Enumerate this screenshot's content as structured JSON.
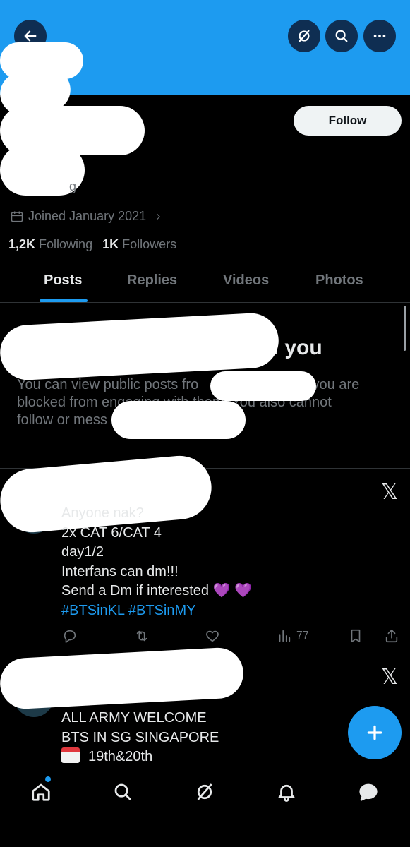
{
  "header": {
    "back_icon": "arrow-left-icon",
    "grok_icon": "grok-icon",
    "search_icon": "search-icon",
    "more_icon": "more-dots-icon",
    "banner_color": "#1d9bf0"
  },
  "profile": {
    "follow_label": "Follow",
    "handle_fragment": "g",
    "joined": "Joined January 2021",
    "following_count": "1,2K",
    "following_label": "Following",
    "followers_count": "1K",
    "followers_label": "Followers"
  },
  "tabs": [
    {
      "label": "Posts",
      "active": true
    },
    {
      "label": "Replies",
      "active": false
    },
    {
      "label": "Videos",
      "active": false
    },
    {
      "label": "Photos",
      "active": false
    }
  ],
  "blocked_notice": {
    "title_fragment": "ed you",
    "line1_a": "You can view public posts fro",
    "line1_b": "out you are",
    "line2": "blocked from engaging with them. You also cannot",
    "line3": "follow or mess"
  },
  "posts": [
    {
      "lines": [
        "Anyone nak?",
        "2x CAT 6/CAT 4",
        "day1/2",
        "Interfans can dm!!!",
        "Send a Dm if interested 💜 💜"
      ],
      "hashtags": "#BTSinKL #BTSinMY",
      "views": "77"
    },
    {
      "lines": [
        "ALL ARMY WELCOME",
        "BTS IN SG SINGAPORE",
        "19th&20th"
      ]
    }
  ],
  "x_logo": "𝕏",
  "accent_color": "#1d9bf0"
}
